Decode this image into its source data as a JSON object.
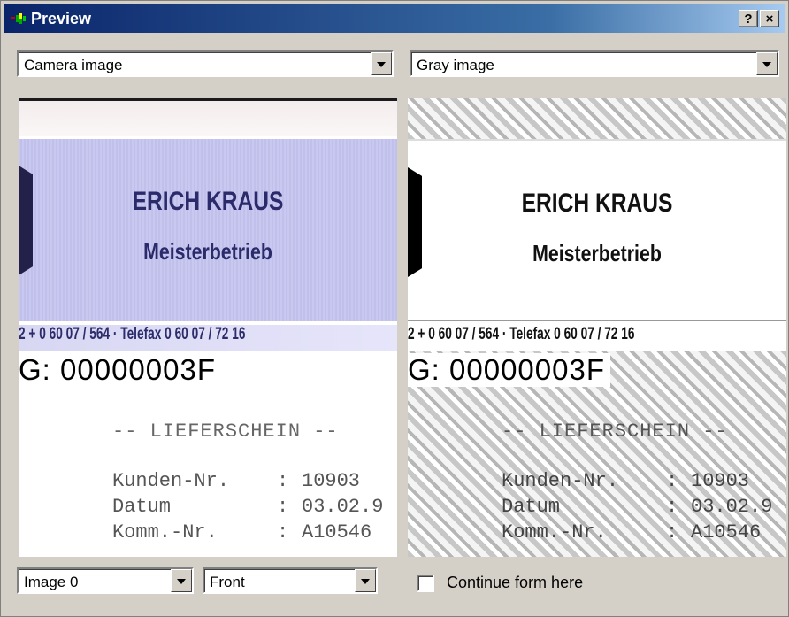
{
  "window": {
    "title": "Preview",
    "help_label": "?",
    "close_label": "×"
  },
  "left_panel": {
    "mode_select": "Camera image",
    "document": {
      "company_line1": "ERICH KRAUS",
      "company_line2": "Meisterbetrieb",
      "phone_line": "2 + 0 60 07 / 564 · Telefax 0 60 07 / 72 16",
      "code_line": "G: 00000003F",
      "heading": "-- LIEFERSCHEIN --",
      "rows": [
        {
          "label": "Kunden-Nr.",
          "value": "10903"
        },
        {
          "label": "Datum",
          "value": "03.02.9"
        },
        {
          "label": "Komm.-Nr.",
          "value": "A10546"
        }
      ]
    },
    "image_select": "Image 0",
    "side_select": "Front"
  },
  "right_panel": {
    "mode_select": "Gray image",
    "document": {
      "company_line1": "ERICH KRAUS",
      "company_line2": "Meisterbetrieb",
      "phone_line": "2 + 0 60 07 / 564 · Telefax 0 60 07 / 72 16",
      "code_line": "G: 00000003F",
      "heading": "-- LIEFERSCHEIN --",
      "rows": [
        {
          "label": "Kunden-Nr.",
          "value": "10903"
        },
        {
          "label": "Datum",
          "value": "03.02.9"
        },
        {
          "label": "Komm.-Nr.",
          "value": "A10546"
        }
      ]
    },
    "continue_checkbox_label": "Continue form here",
    "continue_checked": false
  },
  "colors": {
    "titlebar_start": "#0a246a",
    "titlebar_end": "#a6caf0",
    "camera_band": "#c9c8f0",
    "ink": "#2b2a6a"
  }
}
